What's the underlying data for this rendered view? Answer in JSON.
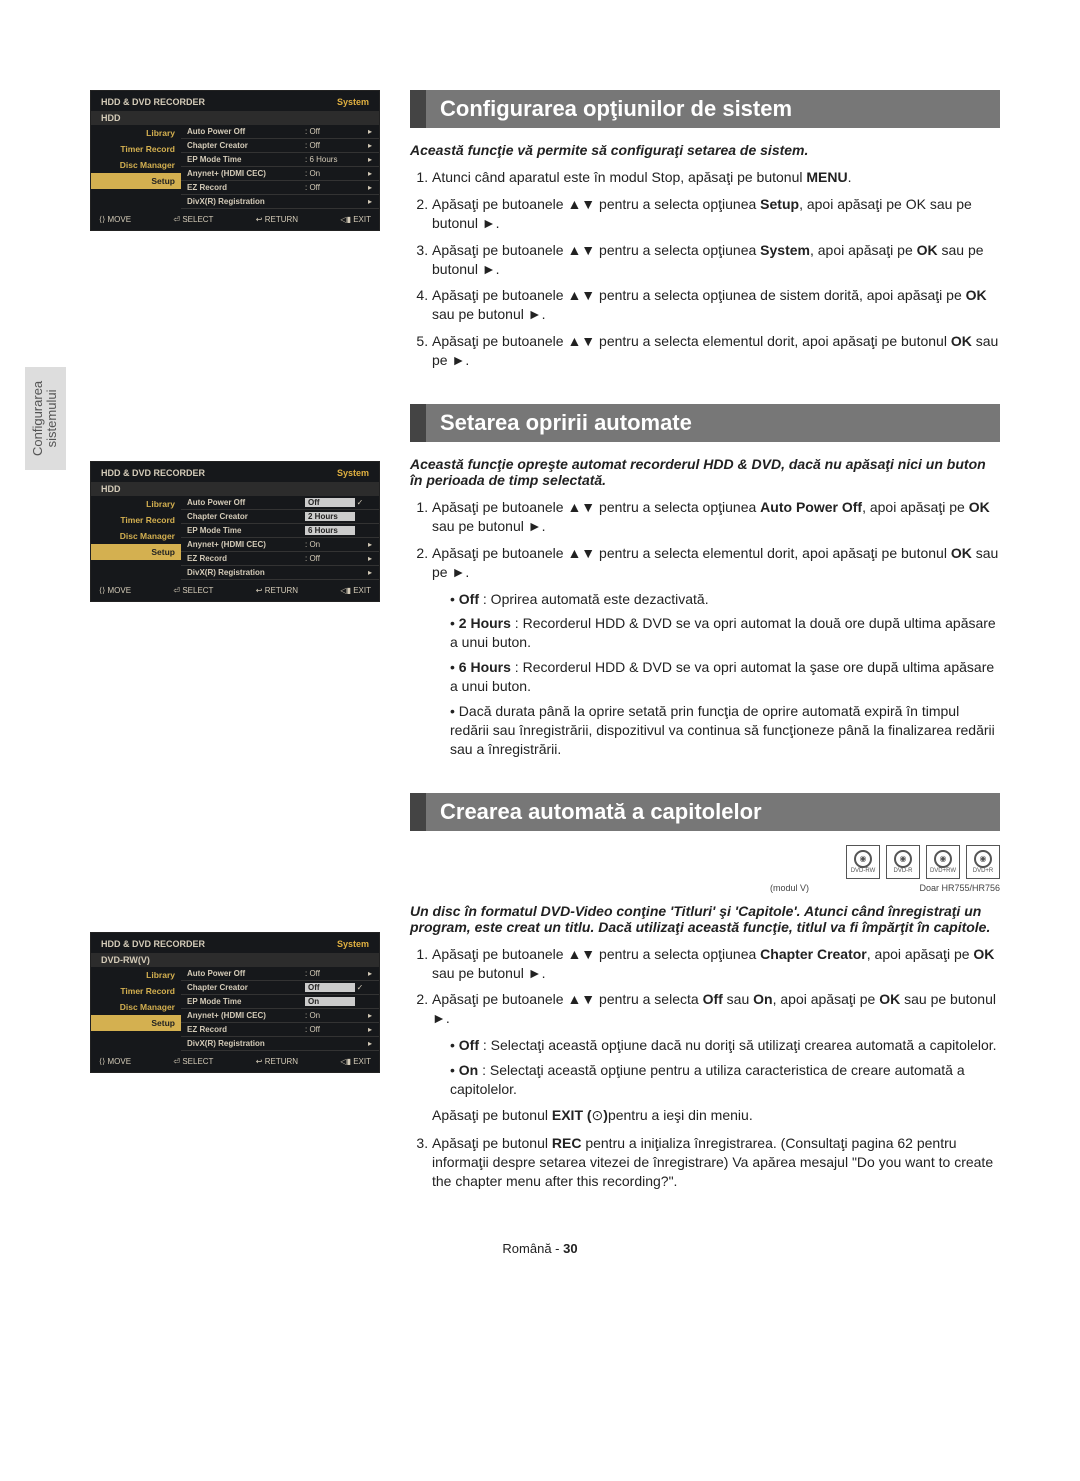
{
  "sideTab": {
    "line1": "Configurarea",
    "line2": "sistemului"
  },
  "osd_common": {
    "header": "HDD & DVD RECORDER",
    "system": "System",
    "menu": {
      "library": "Library",
      "timer": "Timer Record",
      "disc": "Disc Manager",
      "setup": "Setup"
    },
    "bottom": {
      "move": "⟨⟩ MOVE",
      "select": "⏎ SELECT",
      "return": "↩ RETURN",
      "exit": "◁▮ EXIT"
    }
  },
  "osd1": {
    "sub": "HDD",
    "rows": [
      {
        "k": "Auto Power Off",
        "v": ": Off",
        "arrow": "▸"
      },
      {
        "k": "Chapter Creator",
        "v": ": Off",
        "arrow": "▸"
      },
      {
        "k": "EP Mode Time",
        "v": ": 6 Hours",
        "arrow": "▸"
      },
      {
        "k": "Anynet+ (HDMI CEC)",
        "v": ": On",
        "arrow": "▸"
      },
      {
        "k": "EZ Record",
        "v": ": Off",
        "arrow": "▸"
      },
      {
        "k": "DivX(R) Registration",
        "v": "",
        "arrow": "▸"
      }
    ]
  },
  "osd2": {
    "sub": "HDD",
    "rows": [
      {
        "k": "Auto Power Off",
        "v": "Off",
        "box": true,
        "check": "✓"
      },
      {
        "k": "Chapter Creator",
        "v": "2 Hours",
        "box": true
      },
      {
        "k": "EP Mode Time",
        "v": "6 Hours",
        "box": true
      },
      {
        "k": "Anynet+ (HDMI CEC)",
        "v": ": On",
        "arrow": "▸"
      },
      {
        "k": "EZ Record",
        "v": ": Off",
        "arrow": "▸"
      },
      {
        "k": "DivX(R) Registration",
        "v": "",
        "arrow": "▸"
      }
    ]
  },
  "osd3": {
    "sub": "DVD-RW(V)",
    "rows": [
      {
        "k": "Auto Power Off",
        "v": ": Off",
        "arrow": "▸"
      },
      {
        "k": "Chapter Creator",
        "v": "Off",
        "box": true,
        "check": "✓"
      },
      {
        "k": "EP Mode Time",
        "v": "On",
        "box": true
      },
      {
        "k": "Anynet+ (HDMI CEC)",
        "v": ": On",
        "arrow": "▸"
      },
      {
        "k": "EZ Record",
        "v": ": Off",
        "arrow": "▸"
      },
      {
        "k": "DivX(R) Registration",
        "v": "",
        "arrow": "▸"
      }
    ]
  },
  "sec1": {
    "title": "Configurarea opţiunilor de sistem",
    "subtitle": "Această funcţie vă permite să configuraţi setarea de sistem.",
    "steps": [
      "Atunci când aparatul este în modul Stop, apăsaţi pe butonul <b>MENU</b>.",
      "Apăsaţi pe butoanele ▲▼ pentru a selecta opţiunea <b>Setup</b>, apoi apăsaţi pe OK sau pe butonul ►.",
      "Apăsaţi pe butoanele ▲▼ pentru a selecta opţiunea <b>System</b>, apoi apăsaţi pe <b>OK</b> sau pe butonul ►.",
      "Apăsaţi pe butoanele ▲▼ pentru a selecta opţiunea de sistem dorită, apoi apăsaţi pe <b>OK</b> sau pe butonul ►.",
      "Apăsaţi pe butoanele ▲▼ pentru a selecta elementul dorit, apoi apăsaţi pe butonul <b>OK</b> sau pe ►."
    ]
  },
  "sec2": {
    "title": "Setarea opririi automate",
    "subtitle": "Această funcţie opreşte automat recorderul HDD & DVD, dacă nu apăsaţi nici un buton în perioada de timp selectată.",
    "steps": [
      "Apăsaţi pe butoanele ▲▼ pentru a selecta opţiunea <b>Auto Power Off</b>, apoi apăsaţi pe <b>OK</b> sau pe butonul ►.",
      "Apăsaţi pe butoanele ▲▼ pentru a selecta elementul dorit, apoi apăsaţi pe butonul <b>OK</b> sau pe ►."
    ],
    "bullets": [
      "<b>Off</b> : Oprirea automată este dezactivată.",
      "<b>2 Hours</b> : Recorderul HDD & DVD se va opri automat la două ore după ultima apăsare a unui buton.",
      "<b>6 Hours</b> : Recorderul HDD & DVD se va opri automat la şase ore după ultima apăsare a unui buton.",
      "Dacă durata până la oprire setată prin funcţia de oprire automată expiră în timpul redării sau înregistrării, dispozitivul va continua să funcţioneze până la finalizarea redării sau a înregistrării."
    ]
  },
  "sec3": {
    "title": "Crearea automată a capitolelor",
    "disc_labels": [
      "DVD-RW",
      "DVD-R",
      "DVD+RW",
      "DVD+R"
    ],
    "disc_caps": {
      "left": "(modul V)",
      "right": "Doar HR755/HR756"
    },
    "subtitle": "Un disc în formatul DVD-Video conţine 'Titluri' şi 'Capitole'. Atunci când înregistraţi un program, este creat un titlu. Dacă utilizaţi această funcţie, titlul va fi împărţit în capitole.",
    "steps": [
      "Apăsaţi pe butoanele ▲▼ pentru a selecta opţiunea <b>Chapter Creator</b>, apoi apăsaţi pe <b>OK</b> sau pe butonul ►.",
      "Apăsaţi pe butoanele ▲▼ pentru a selecta <b>Off</b> sau <b>On</b>, apoi apăsaţi pe <b>OK</b> sau pe butonul ►."
    ],
    "bullets": [
      "<b>Off</b> : Selectaţi această opţiune dacă nu doriţi să utilizaţi crearea automată a capitolelor.",
      "<b>On</b> : Selectaţi această opţiune pentru a utiliza caracteristica de creare automată a capitolelor."
    ],
    "after_bullets": "Apăsaţi pe butonul <b>EXIT (</b>⊙<b>)</b>pentru a ieşi din meniu.",
    "step3": "Apăsaţi pe butonul <b>REC</b> pentru a iniţializa înregistrarea. (Consultaţi pagina 62 pentru informaţii despre setarea vitezei de înregistrare) Va apărea mesajul \"Do you want to create the chapter menu after this recording?\"."
  },
  "footer": {
    "lang": "Română",
    "sep": " - ",
    "page": "30"
  }
}
